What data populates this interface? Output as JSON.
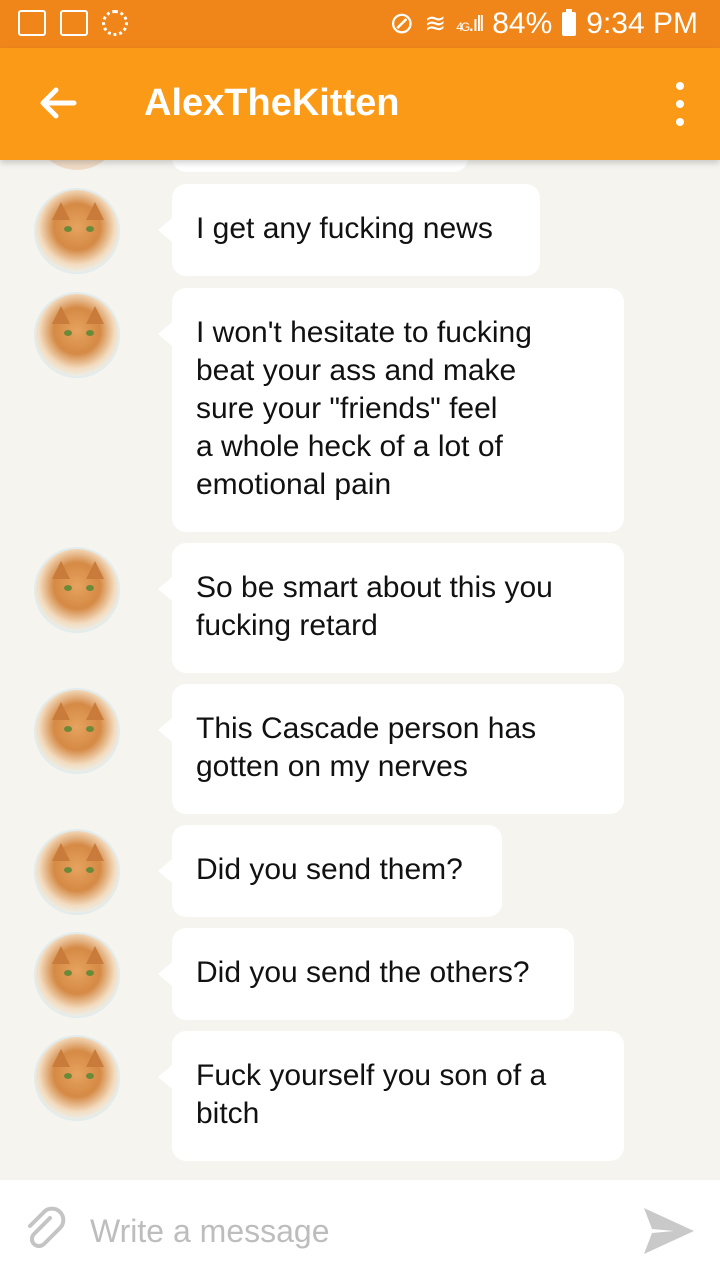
{
  "status_bar": {
    "battery": "84%",
    "time": "9:34 PM",
    "network": "4G"
  },
  "app_bar": {
    "title": "AlexTheKitten"
  },
  "messages": [
    {
      "text": "I get any fucking news"
    },
    {
      "text": "I won't hesitate to fucking\nbeat your ass and make\nsure your \"friends\" feel\na whole heck of a lot of\nemotional pain"
    },
    {
      "text": "So be smart about this you\nfucking retard"
    },
    {
      "text": "This Cascade person has\ngotten on my nerves"
    },
    {
      "text": "Did you send them?"
    },
    {
      "text": "Did you send the others?"
    },
    {
      "text": "Fuck yourself you son of a\nbitch"
    }
  ],
  "composer": {
    "placeholder": "Write a message"
  },
  "icons": {
    "back": "arrow-left-icon",
    "menu": "more-vertical-icon",
    "attach": "paperclip-icon",
    "send": "send-icon"
  }
}
